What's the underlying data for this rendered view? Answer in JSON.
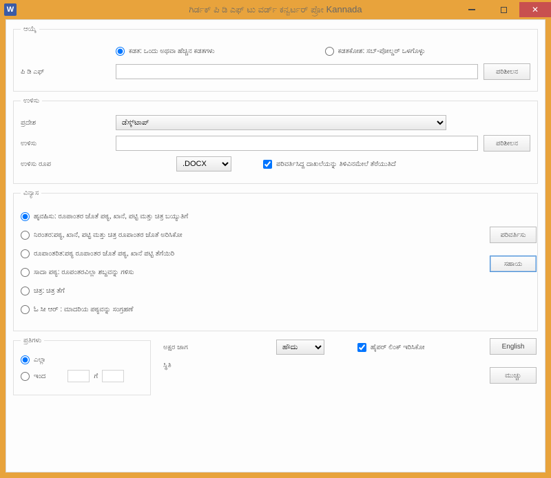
{
  "window": {
    "title": "ಗಿರ್ಡಕ್ ಪಿ ಡಿ ಎಫ್  ಟು ವರ್ಡ್ ಕನ್ವರ್ಟರ್ ಪ್ರೋ Kannada"
  },
  "select_group": {
    "legend": "ಆಯ್ಕೆ",
    "radio_file": "ಕಡತ: ಒಂದು ಅಥವಾ ಹೆಚ್ಚಿನ ಕಡತಗಳು",
    "radio_folder": "ಕಡತಕೋಶ: ಸಬ್-ಪೋಲ್ಡರ್ ಒಳಗೊಳ್ಳು",
    "pdf_label": "ಪಿ ಡಿ ಎಫ್",
    "browse": "ಪರಿಶೀಲನ"
  },
  "save_group": {
    "legend": "ಉಳಿಸು",
    "location_label": "ಪ್ರದೇಶ",
    "location_value": "ಡೆಸ್ಕ್‌ಟಾಪ್",
    "save_label": "ಉಳಿಸು",
    "browse": "ಪರಿಶೀಲನ",
    "format_label": "ಉಳಿಸು ರೂಪ",
    "format_value": ".DOCX",
    "open_after": "ಪರಿವರ್ತಿಸಿದ್ದ ದಾಖಲೆಯನ್ನು ತಿಳಿವಿನಮೇಲೆ ತೆರೆಯುತಿದೆ"
  },
  "layout_group": {
    "legend": "ವಿನ್ಯಾಸ",
    "opt1": "ಹೃವಹಿಸು: ರೂಪಾಂತರ ಜೊತೆ ಪಠ್ಯ, ಖಾನೆ, ಪಟ್ಟಿ ಮತ್ತು ಚಿತ್ರ ಬಯ್ಯುತಿಗೆ",
    "opt2": "ನಿರಂತರ:ಪಠ್ಯ, ಖಾನೆ, ಪಟ್ಟಿ ಮತ್ತು ಚಿತ್ರ ರೂಪಾಂತರ ಜೊತೆ ಅರಿಸಿಕೋ",
    "opt3": "ರೂಪಾಂತರಿತ:ಪಠ್ಯ ರೂಪಾಂತರ ಜೊತೆ ಪಠ್ಯ, ಖಾನೆ ಪಟ್ಟಿ ತೆಗೆಯಿರಿ",
    "opt4": "ಸಾದಾ ಪಠ್ಯ: ರೂಪಂತರವಿಲ್ಲಾ ಶಬ್ದವನ್ನು ಗಳಿಸು",
    "opt5": "ಚಿತ್ರ: ಚಿತ್ರ ತೆಗೆ",
    "opt6": "ಓ ಸೀ ಆರ್ : ಮಾದರಿಯ ಪಠ್ಯವನ್ನು ಸಂಗ್ರಹಣೆ"
  },
  "side": {
    "convert": "ಪರಿವರ್ತಿಸು",
    "help": "ಸಹಾಯ",
    "english": "English",
    "close": "ಮುಚ್ಚು"
  },
  "pages_group": {
    "legend": "ಪ್ರತಿಗಳು",
    "all": "ಎಲ್ಲಾ",
    "from": "ಇಂದ",
    "to": "ಗೆ"
  },
  "options": {
    "char_spacing_label": "ಅಕ್ಷರ ಜಾಗ",
    "char_spacing_value": "ಹೌದು",
    "hyperlink": "ಹೈಪರ್ ಲಿಂಕ್ ಇರಿಸಿಕೋ",
    "status_label": "ಸ್ಥಿತಿ"
  }
}
